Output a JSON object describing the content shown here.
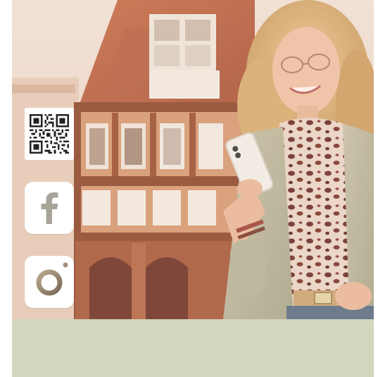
{
  "colors": {
    "footer_band": "#d2d6be",
    "page_background": "#ffffff",
    "icon_tile": "#ffffff",
    "icon_glyph": "#968a7c",
    "facebook_glyph": "#a9a49a"
  },
  "icons": {
    "qr": "qr-code-icon",
    "facebook": "facebook-icon",
    "instagram": "instagram-icon"
  }
}
